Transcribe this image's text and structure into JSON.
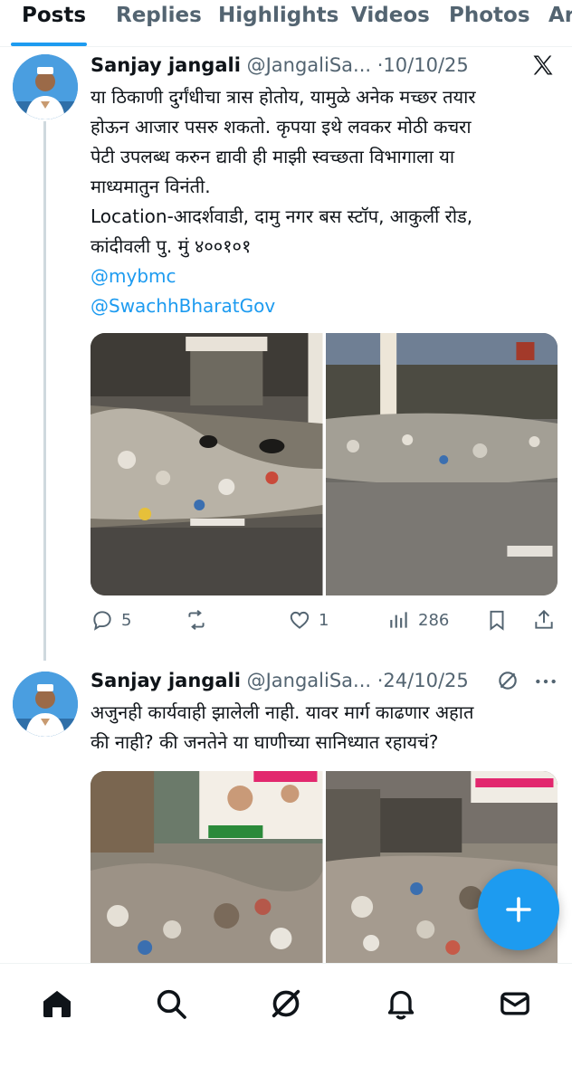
{
  "tabs": [
    {
      "label": "Posts",
      "active": true
    },
    {
      "label": "Replies",
      "active": false
    },
    {
      "label": "Highlights",
      "active": false
    },
    {
      "label": "Videos",
      "active": false
    },
    {
      "label": "Photos",
      "active": false
    },
    {
      "label": "Ar",
      "active": false
    }
  ],
  "posts": [
    {
      "name": "Sanjay jangali",
      "handle": "@JangaliSa...",
      "separator": "·",
      "date": "10/10/25",
      "text_lines": [
        "या ठिकाणी दुर्गंधीचा त्रास होतोय, यामुळे अनेक मच्छर तयार",
        "होऊन आजार पसरु शकतो. कृपया इथे लवकर मोठी कचरा",
        "पेटी उपलब्ध करुन द्यावी ही माझी स्वच्छता विभागाला या",
        "माध्यमातुन विनंती.",
        "Location-आदर्शवाडी, दामु नगर बस स्टॉप, आकुर्ली रोड,",
        "कांदीवली पु. मुं ४००१०१"
      ],
      "mentions": [
        "@mybmc",
        "@SwachhBharatGov"
      ],
      "stats": {
        "replies": "5",
        "reposts": "",
        "likes": "1",
        "views": "286"
      }
    },
    {
      "name": "Sanjay jangali",
      "handle": "@JangaliSa...",
      "separator": "·",
      "date": "24/10/25",
      "text_lines": [
        "अजुनही कार्यवाही झालेली नाही. यावर मार्ग काढणार अहात",
        "की नाही? की जनतेने या घाणीच्या सानिध्यात रहायचं?"
      ]
    }
  ],
  "icons": {
    "reply": "reply-icon",
    "repost": "repost-icon",
    "like": "heart-icon",
    "views": "views-icon",
    "bookmark": "bookmark-icon",
    "share": "share-icon",
    "more": "more-icon",
    "grok": "grok-icon",
    "x": "x-logo-icon",
    "compose": "plus-icon"
  },
  "nav": [
    "home-icon",
    "search-icon",
    "grok-icon",
    "notifications-icon",
    "messages-icon"
  ],
  "colors": {
    "accent": "#1d9bf0",
    "muted": "#536471",
    "text": "#0f1419"
  }
}
